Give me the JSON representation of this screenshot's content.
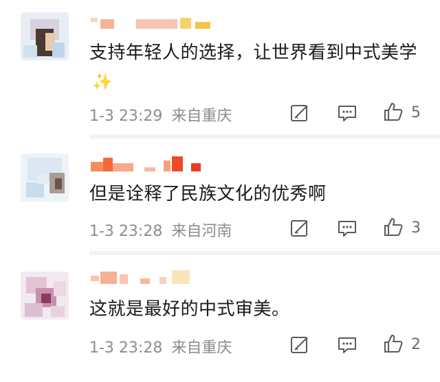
{
  "colors": {
    "meta": "#8c8c8c",
    "sparkle": "#f5c23a",
    "icon": "#5a5a5a"
  },
  "comments": [
    {
      "text": "支持年轻人的选择，让世界看到中式美学",
      "emoji": "✨",
      "time": "1-3 23:29",
      "location": "来自重庆",
      "likes": "5"
    },
    {
      "text": "但是诠释了民族文化的优秀啊",
      "time": "1-3 23:28",
      "location": "来自河南",
      "likes": "3"
    },
    {
      "text": "这就是最好的中式审美。",
      "time": "1-3 23:28",
      "location": "来自重庆",
      "likes": "2"
    }
  ]
}
